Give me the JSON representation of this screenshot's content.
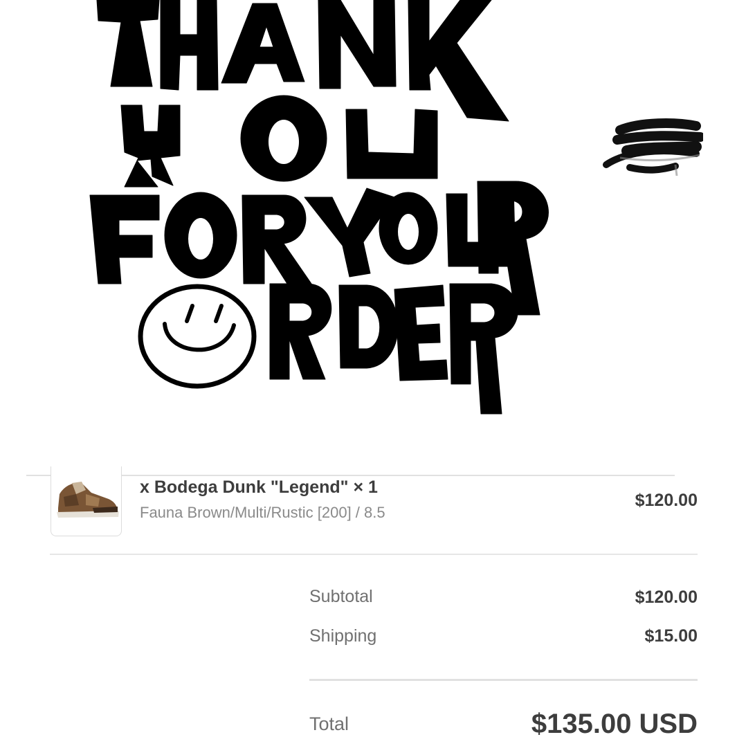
{
  "banner": {
    "lines": [
      "THANK",
      "YOU",
      "FOR YOUR",
      "ORDER"
    ],
    "ink_color": "#000000"
  },
  "redaction": {
    "icon": "redacted-scribble-icon",
    "color": "#111111"
  },
  "order_item": {
    "name": "x Bodega Dunk \"Legend\" × 1",
    "variant": "Fauna Brown/Multi/Rustic [200] / 8.5",
    "price": "$120.00",
    "thumbnail_icon": "sneaker-icon"
  },
  "summary": {
    "subtotal_label": "Subtotal",
    "subtotal_value": "$120.00",
    "shipping_label": "Shipping",
    "shipping_value": "$15.00",
    "total_label": "Total",
    "total_value": "$135.00 USD"
  }
}
